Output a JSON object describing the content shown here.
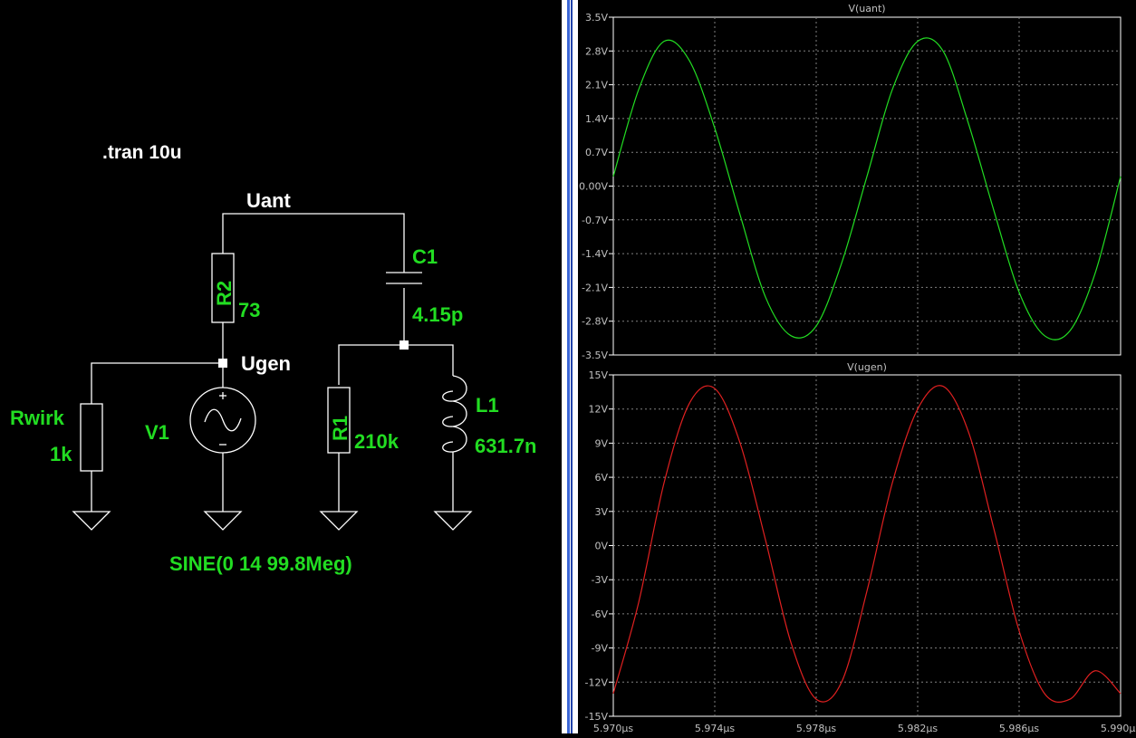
{
  "schematic": {
    "directive": ".tran 10u",
    "nets": {
      "antenna": "Uant",
      "generator": "Ugen"
    },
    "components": {
      "r2": {
        "ref": "R2",
        "value": "73"
      },
      "c1": {
        "ref": "C1",
        "value": "4.15p"
      },
      "r1": {
        "ref": "R1",
        "value": "210k"
      },
      "l1": {
        "ref": "L1",
        "value": "631.7n"
      },
      "rwirk": {
        "ref": "Rwirk",
        "value": "1k"
      },
      "v1": {
        "ref": "V1",
        "value": "SINE(0 14 99.8Meg)"
      }
    },
    "colors": {
      "wire": "#ffffff",
      "label": "#22dd22",
      "background": "#000000"
    }
  },
  "chart_data": [
    {
      "type": "line",
      "title": "V(uant)",
      "color": "#22dd22",
      "x": [
        5.97,
        5.971,
        5.972,
        5.973,
        5.974,
        5.975,
        5.976,
        5.977,
        5.978,
        5.979,
        5.98,
        5.981,
        5.982,
        5.983,
        5.984,
        5.985,
        5.986,
        5.987,
        5.988,
        5.989,
        5.99
      ],
      "y": [
        0.2,
        2.0,
        3.0,
        2.6,
        1.2,
        -0.6,
        -2.3,
        -3.1,
        -2.9,
        -1.6,
        0.2,
        2.0,
        3.0,
        2.8,
        1.3,
        -0.5,
        -2.2,
        -3.1,
        -3.0,
        -1.8,
        0.2
      ],
      "yticks": [
        "3.5V",
        "2.8V",
        "2.1V",
        "1.4V",
        "0.7V",
        "0.00V",
        "-0.7V",
        "-1.4V",
        "-2.1V",
        "-2.8V",
        "-3.5V"
      ],
      "ylim": [
        -3.5,
        3.5
      ],
      "xlim": [
        5.97,
        5.99
      ],
      "grid": true
    },
    {
      "type": "line",
      "title": "V(ugen)",
      "color": "#e02020",
      "x": [
        5.97,
        5.971,
        5.972,
        5.973,
        5.974,
        5.975,
        5.976,
        5.977,
        5.978,
        5.979,
        5.98,
        5.981,
        5.982,
        5.983,
        5.984,
        5.985,
        5.986,
        5.987,
        5.988,
        5.989,
        5.99
      ],
      "y": [
        -13.0,
        -5.0,
        5.5,
        12.5,
        13.8,
        9.0,
        0.5,
        -8.5,
        -13.5,
        -12.0,
        -4.0,
        5.5,
        12.0,
        14.0,
        10.0,
        1.5,
        -7.5,
        -13.0,
        -13.5,
        -11.0,
        -13.0
      ],
      "yticks": [
        "15V",
        "12V",
        "9V",
        "6V",
        "3V",
        "0V",
        "-3V",
        "-6V",
        "-9V",
        "-12V",
        "-15V"
      ],
      "ylim": [
        -15,
        15
      ],
      "xlim": [
        5.97,
        5.99
      ],
      "xticks": [
        "5.970µs",
        "5.974µs",
        "5.978µs",
        "5.982µs",
        "5.986µs",
        "5.990µs"
      ],
      "grid": true
    }
  ]
}
